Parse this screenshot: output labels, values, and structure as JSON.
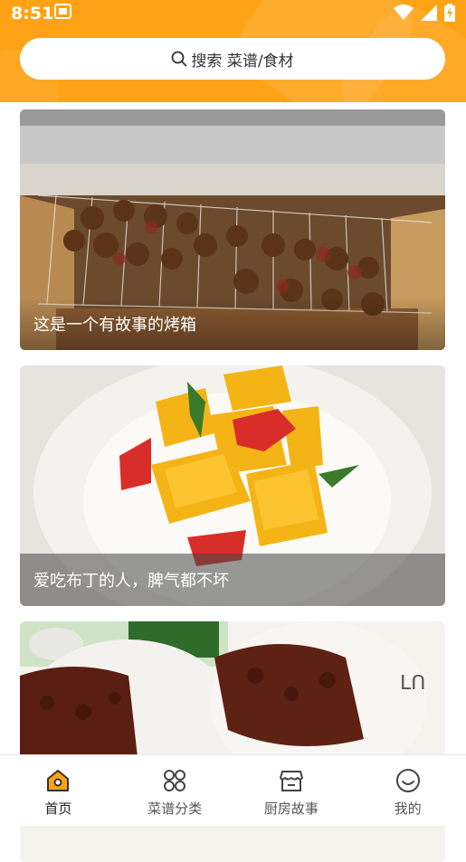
{
  "status_bar": {
    "time": "8:51",
    "icons": [
      "wifi-icon",
      "cell-signal-icon",
      "battery-charging-icon"
    ]
  },
  "search": {
    "placeholder": "搜索 菜谱/食材"
  },
  "feed": {
    "cards": [
      {
        "title": "这是一个有故事的烤箱"
      },
      {
        "title": "爱吃布丁的人，脾气都不坏"
      },
      {
        "title": ""
      }
    ]
  },
  "tabbar": {
    "tabs": [
      {
        "label": "首页",
        "icon": "home-icon",
        "active": true
      },
      {
        "label": "菜谱分类",
        "icon": "category-grid-icon",
        "active": false
      },
      {
        "label": "厨房故事",
        "icon": "store-icon",
        "active": false
      },
      {
        "label": "我的",
        "icon": "smiley-profile-icon",
        "active": false
      }
    ]
  },
  "colors": {
    "accent": "#FFA215",
    "tab_active": "#FFA215",
    "tab_inactive": "#555555"
  }
}
